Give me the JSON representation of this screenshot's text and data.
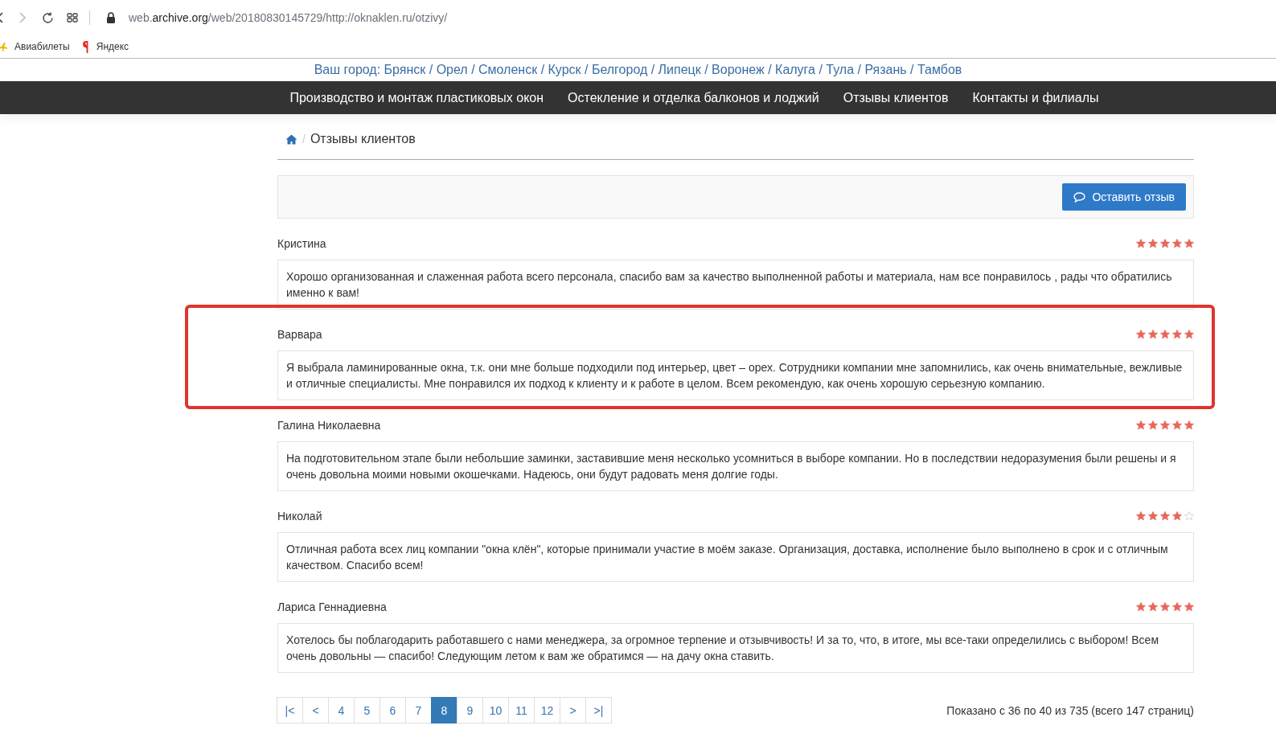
{
  "browser": {
    "url": "web.**archive.org**/web/20180830145729/http://oknaklen.ru/otzivy/",
    "bookmarks": [
      {
        "label": "Авиабилеты",
        "kind": "plane"
      },
      {
        "label": "Яндекс",
        "kind": "yandex"
      }
    ]
  },
  "city_line": "Ваш город: Брянск / Орел / Смоленск / Курск / Белгород / Липецк / Воронеж / Калуга / Тула / Рязань / Тамбов",
  "nav": [
    "Производство и монтаж пластиковых окон",
    "Остекление и отделка балконов и лоджий",
    "Отзывы клиентов",
    "Контакты и филиалы"
  ],
  "breadcrumb": {
    "separator": "/",
    "current": "Отзывы клиентов"
  },
  "leave_review_button": "Оставить отзыв",
  "reviews": [
    {
      "name": "Кристина",
      "stars": 5,
      "highlighted": false,
      "text": "Хорошо организованная и слаженная работа всего персонала, спасибо вам за качество выполненной работы и материала, нам все понравилось , рады что обратились именно к вам!"
    },
    {
      "name": "Варвара",
      "stars": 5,
      "highlighted": true,
      "text": "Я выбрала ламинированные окна, т.к. они мне больше подходили под интерьер, цвет – орех. Сотрудники компании мне запомнились, как очень внимательные, вежливые и отличные специалисты. Мне понравился их подход к клиенту и к работе в целом. Всем рекомендую, как очень хорошую серьезную компанию."
    },
    {
      "name": "Галина Николаевна",
      "stars": 5,
      "highlighted": false,
      "text": "На подготовительном этапе были небольшие заминки, заставившие меня несколько усомниться в выборе компании. Но в последствии недоразумения были решены и я очень довольна моими новыми окошечками. Надеюсь, они будут радовать меня долгие годы."
    },
    {
      "name": "Николай",
      "stars": 4,
      "highlighted": false,
      "text": "Отличная работа всех лиц компании \"окна клён\", которые принимали участие в моём заказе. Организация, доставка, исполнение было выполнено в срок и с отличным качеством. Спасибо всем!"
    },
    {
      "name": "Лариса Геннадиевна",
      "stars": 5,
      "highlighted": false,
      "text": "Хотелось бы поблагодарить работавшего с нами менеджера, за огромное терпение и отзывчивость! И за то, что, в итоге, мы все-таки определились с выбором! Всем очень довольны — спасибо! Следующим летом к вам же обратимся — на дачу окна ставить."
    }
  ],
  "pagination": [
    {
      "label": "|<",
      "selected": false
    },
    {
      "label": "<",
      "selected": false
    },
    {
      "label": "4",
      "selected": false
    },
    {
      "label": "5",
      "selected": false
    },
    {
      "label": "6",
      "selected": false
    },
    {
      "label": "7",
      "selected": false
    },
    {
      "label": "8",
      "selected": true
    },
    {
      "label": "9",
      "selected": false
    },
    {
      "label": "10",
      "selected": false
    },
    {
      "label": "11",
      "selected": false
    },
    {
      "label": "12",
      "selected": false
    },
    {
      "label": ">",
      "selected": false
    },
    {
      "label": ">|",
      "selected": false
    }
  ],
  "summary": "Показано с 36 по 40 из 735 (всего 147 страниц)"
}
